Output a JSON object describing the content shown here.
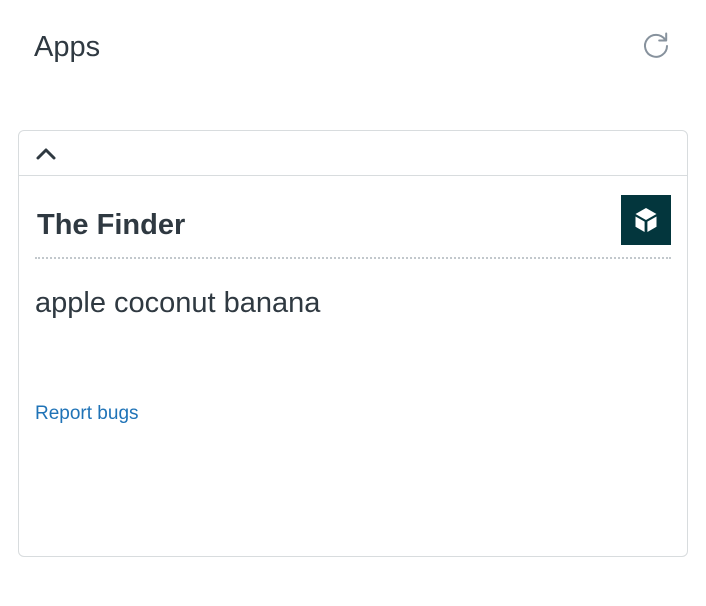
{
  "header": {
    "title": "Apps",
    "refresh_icon": "refresh-icon"
  },
  "panel": {
    "collapse_icon": "chevron-up-icon",
    "app": {
      "name": "The Finder",
      "icon": "cube-icon",
      "icon_bg": "#03363d",
      "body_text": "apple coconut banana",
      "report_link": "Report bugs"
    }
  },
  "colors": {
    "text": "#2f3941",
    "link": "#1f73b7",
    "border": "#d8dcde"
  }
}
